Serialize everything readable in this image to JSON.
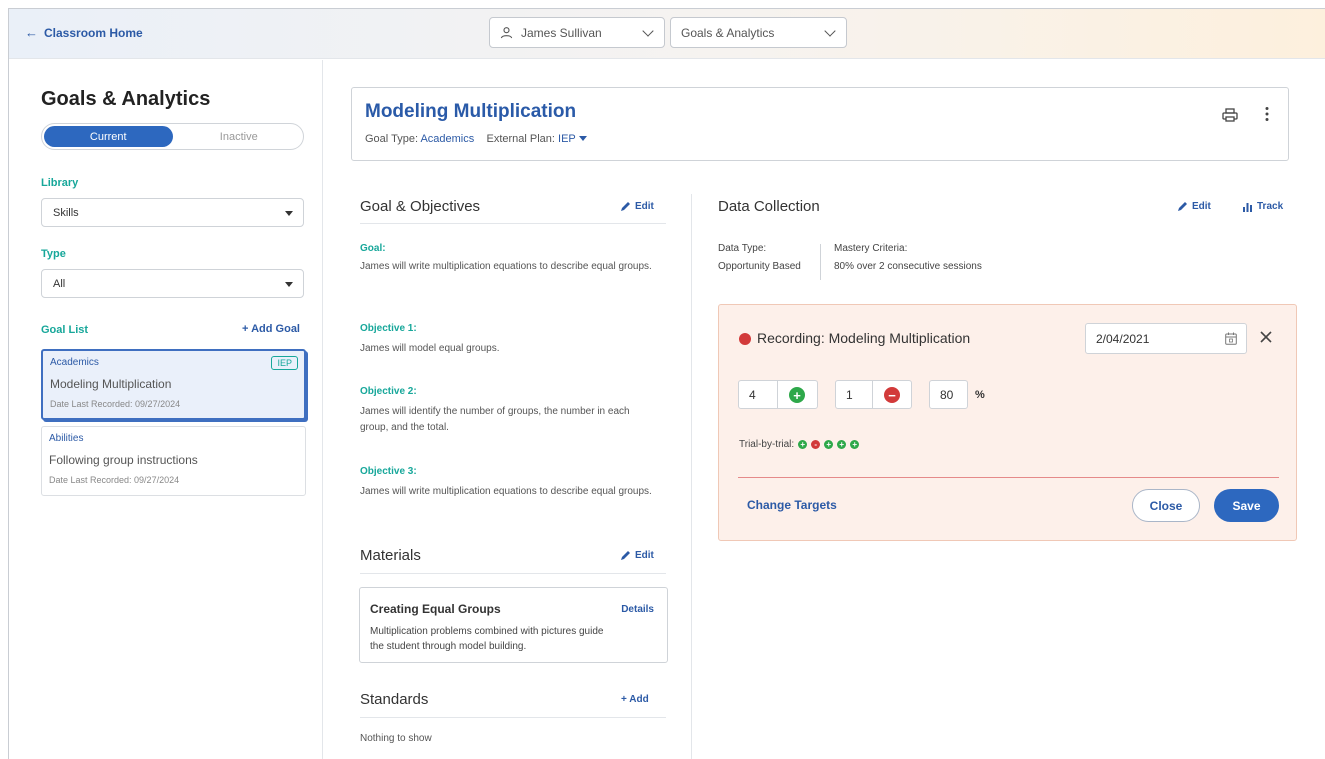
{
  "topbar": {
    "back_label": "Classroom Home",
    "student_select": "James Sullivan",
    "page_select": "Goals & Analytics"
  },
  "sidebar": {
    "title": "Goals & Analytics",
    "toggle": {
      "current": "Current",
      "inactive": "Inactive",
      "selected": "Current"
    },
    "library_label": "Library",
    "library_value": "Skills",
    "type_label": "Type",
    "type_value": "All",
    "goal_list_label": "Goal List",
    "add_goal_label": "+ Add Goal",
    "goals": [
      {
        "category": "Academics",
        "badge": "IEP",
        "name": "Modeling Multiplication",
        "date": "Date Last Recorded: 09/27/2024",
        "selected": true
      },
      {
        "category": "Abilities",
        "badge": "",
        "name": "Following group instructions",
        "date": "Date Last Recorded: 09/27/2024",
        "selected": false
      }
    ]
  },
  "header": {
    "title": "Modeling Multiplication",
    "goal_type_label": "Goal Type:",
    "goal_type_value": "Academics",
    "external_plan_label": "External Plan:",
    "external_plan_value": "IEP"
  },
  "goal_objectives": {
    "title": "Goal & Objectives",
    "edit_label": "Edit",
    "goal_label": "Goal:",
    "goal_text": "James will write multiplication equations to describe equal groups.",
    "objectives": [
      {
        "label": "Objective 1:",
        "text": "James will model equal groups."
      },
      {
        "label": "Objective 2:",
        "text": "James will identify the number of groups, the number in each group, and the total."
      },
      {
        "label": "Objective 3:",
        "text": "James will write multiplication equations to describe equal groups."
      }
    ]
  },
  "materials": {
    "title": "Materials",
    "edit_label": "Edit",
    "card_title": "Creating Equal Groups",
    "card_desc": "Multiplication problems combined with pictures guide the student through model building.",
    "details_label": "Details"
  },
  "standards": {
    "title": "Standards",
    "add_label": "+ Add",
    "empty_text": "Nothing to show"
  },
  "data_collection": {
    "title": "Data Collection",
    "edit_label": "Edit",
    "track_label": "Track",
    "data_type_label": "Data Type:",
    "data_type_value": "Opportunity Based",
    "mastery_label": "Mastery Criteria:",
    "mastery_value": "80% over 2 consecutive sessions"
  },
  "recording": {
    "title": "Recording: Modeling Multiplication",
    "date": "2/04/2021",
    "correct_count": "4",
    "incorrect_count": "1",
    "percent": "80",
    "percent_symbol": "%",
    "trial_label": "Trial-by-trial:",
    "trials": [
      "+",
      "-",
      "+",
      "+",
      "+"
    ],
    "change_targets_label": "Change Targets",
    "close_label": "Close",
    "save_label": "Save"
  },
  "colors": {
    "primary": "#2d68bf",
    "teal": "#17a79a",
    "success": "#2ea84a",
    "danger": "#d23a3a",
    "recording_bg": "#fdf0ea"
  },
  "icons": [
    "arrow-left-icon",
    "person-icon",
    "chevron-down-icon",
    "print-icon",
    "kebab-icon",
    "pencil-icon",
    "bar-chart-icon",
    "calendar-icon",
    "close-icon",
    "plus-circle-icon",
    "minus-circle-icon"
  ]
}
